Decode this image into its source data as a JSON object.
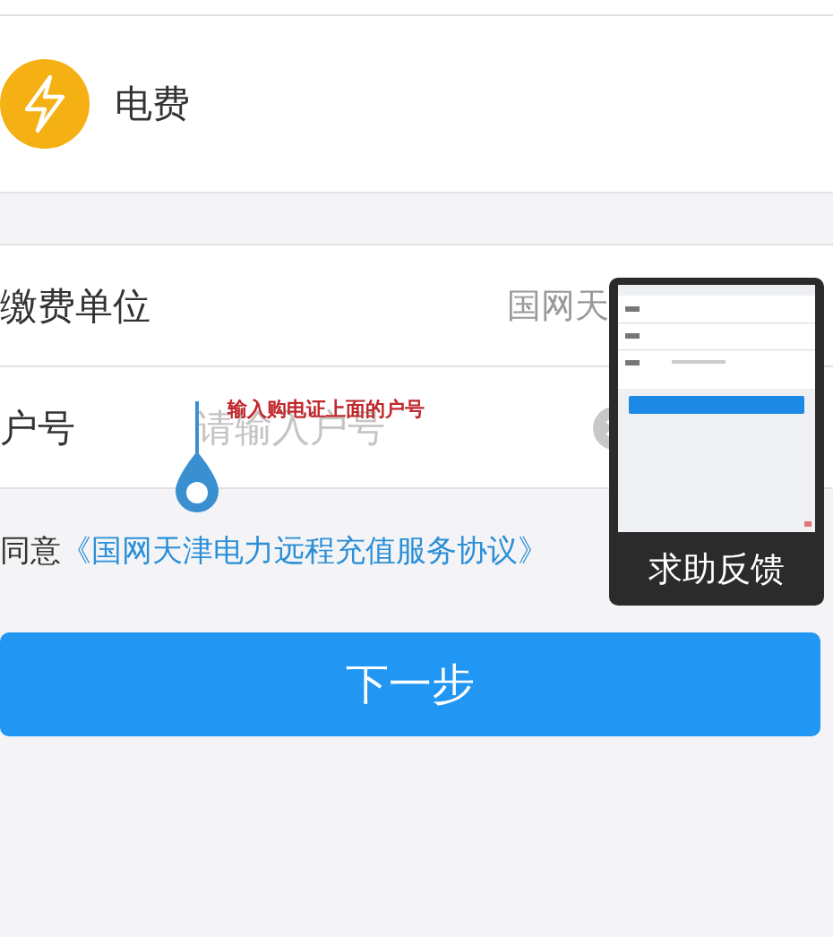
{
  "service": {
    "name": "电费"
  },
  "fields": [
    {
      "label": "缴费单位",
      "value": "国网天"
    },
    {
      "label": "户号",
      "placeholder": "请输入户号"
    }
  ],
  "annotation": {
    "text": "输入购电证上面的户号"
  },
  "agreement": {
    "prefix": "同意",
    "link": "《国网天津电力远程充值服务协议》"
  },
  "next_button": "下一步",
  "feedback": {
    "label": "求助反馈"
  }
}
